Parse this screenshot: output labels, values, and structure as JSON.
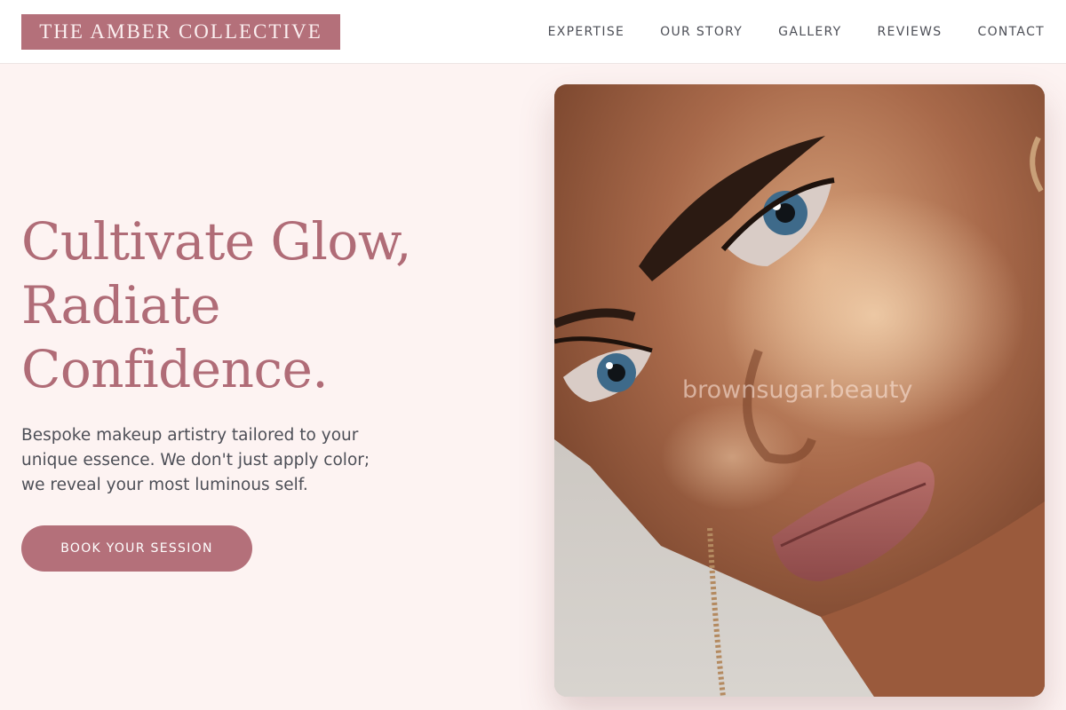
{
  "header": {
    "logo_text": "THE AMBER COLLECTIVE",
    "nav": [
      {
        "label": "EXPERTISE"
      },
      {
        "label": "OUR STORY"
      },
      {
        "label": "GALLERY"
      },
      {
        "label": "REVIEWS"
      },
      {
        "label": "CONTACT"
      }
    ]
  },
  "hero": {
    "title_lines": [
      "Cultivate Glow,",
      "Radiate",
      "Confidence."
    ],
    "subtitle_lines": [
      "Bespoke makeup artistry tailored to your",
      "unique essence. We don't just apply color;",
      "we reveal your most luminous self."
    ],
    "cta_label": "BOOK YOUR SESSION",
    "image": {
      "subject": "close-up beauty portrait of a woman with blue eyes, bronze glowing skin and mauve lipstick",
      "watermark": "brownsugar.beauty"
    }
  },
  "colors": {
    "accent": "#b4707a",
    "headline": "#b06c77",
    "page_background": "#fdf3f2",
    "header_background": "#ffffff",
    "body_text": "#4d4f57"
  }
}
